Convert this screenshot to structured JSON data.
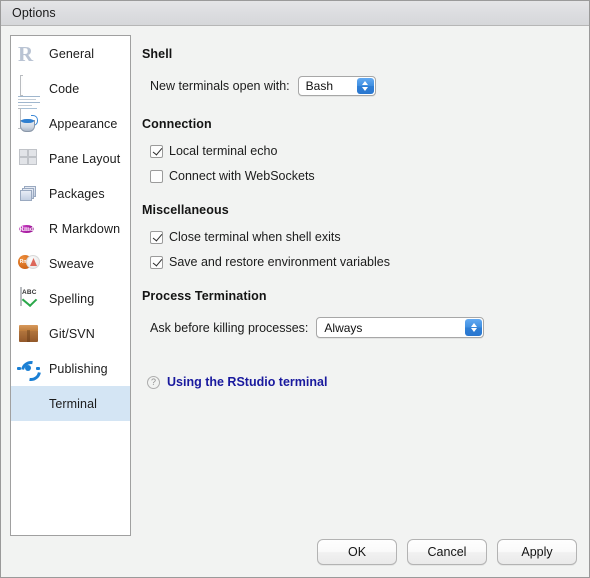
{
  "window": {
    "title": "Options"
  },
  "sidebar": {
    "items": [
      {
        "label": "General",
        "icon": "r-logo-icon",
        "selected": false
      },
      {
        "label": "Code",
        "icon": "document-icon",
        "selected": false
      },
      {
        "label": "Appearance",
        "icon": "paint-bucket-icon",
        "selected": false
      },
      {
        "label": "Pane Layout",
        "icon": "grid-panes-icon",
        "selected": false
      },
      {
        "label": "Packages",
        "icon": "boxes-icon",
        "selected": false
      },
      {
        "label": "R Markdown",
        "icon": "rmd-circle-icon",
        "selected": false
      },
      {
        "label": "Sweave",
        "icon": "sweave-pdf-icon",
        "selected": false
      },
      {
        "label": "Spelling",
        "icon": "abc-check-icon",
        "selected": false
      },
      {
        "label": "Git/SVN",
        "icon": "package-box-icon",
        "selected": false
      },
      {
        "label": "Publishing",
        "icon": "publish-ring-icon",
        "selected": false
      },
      {
        "label": "Terminal",
        "icon": "terminal-icon",
        "selected": true
      }
    ],
    "selected_label": "Terminal",
    "selection_color": "#d4e5f4"
  },
  "main": {
    "sections": {
      "shell": {
        "header": "Shell",
        "field_label": "New terminals open with:",
        "dropdown_value": "Bash",
        "dropdown_options": [
          "Bash"
        ]
      },
      "connection": {
        "header": "Connection",
        "checkboxes": [
          {
            "label": "Local terminal echo",
            "checked": true
          },
          {
            "label": "Connect with WebSockets",
            "checked": false
          }
        ]
      },
      "miscellaneous": {
        "header": "Miscellaneous",
        "checkboxes": [
          {
            "label": "Close terminal when shell exits",
            "checked": true
          },
          {
            "label": "Save and restore environment variables",
            "checked": true
          }
        ]
      },
      "process_termination": {
        "header": "Process Termination",
        "field_label": "Ask before killing processes:",
        "dropdown_value": "Always",
        "dropdown_options": [
          "Always"
        ]
      }
    },
    "help": {
      "icon": "question-mark-icon",
      "link_text": "Using the RStudio terminal",
      "link_color": "#19199e"
    }
  },
  "footer": {
    "ok_label": "OK",
    "cancel_label": "Cancel",
    "apply_label": "Apply"
  }
}
